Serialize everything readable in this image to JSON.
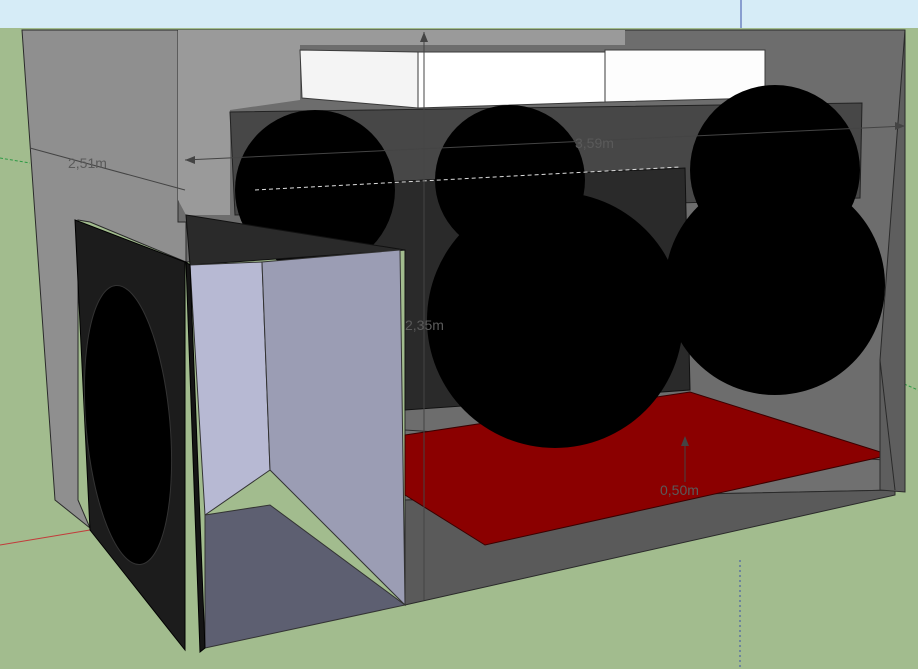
{
  "viewport": {
    "description_colors": {
      "sky": "#d6ecf7",
      "ground": "#a2bc8e",
      "box_wall": "#8e8e8e",
      "box_wall_dark": "#6e6e6e",
      "floor_panel": "#8b0000",
      "sphere": "#000000",
      "white_block": "#ffffff",
      "inner_box_light": "#b7b9d3",
      "inner_box_mid": "#9b9db4",
      "inner_box_floor": "#5d5f71"
    }
  },
  "dimensions": {
    "width": "2,51m",
    "length": "3,59m",
    "height": "2,35m",
    "lift": "0,50m"
  }
}
